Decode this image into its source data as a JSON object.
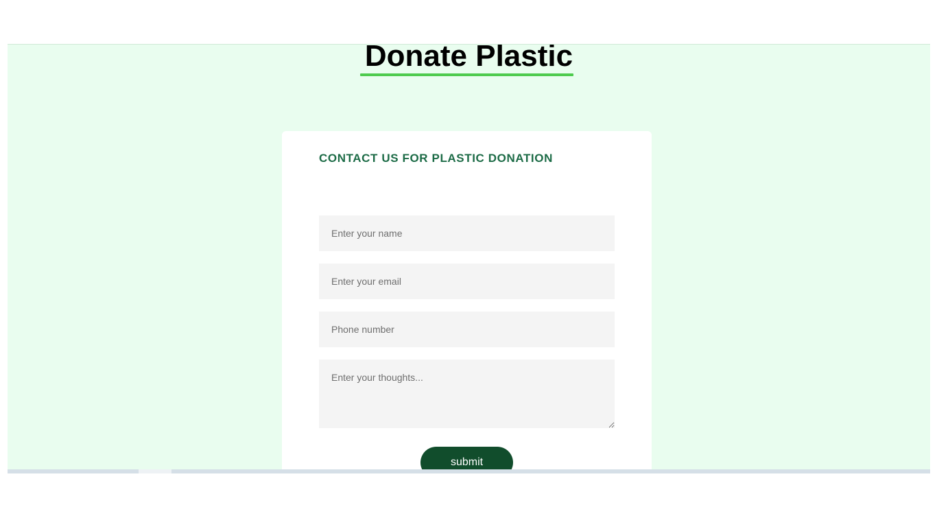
{
  "page": {
    "title": "Donate Plastic"
  },
  "form": {
    "heading": "CONTACT US FOR PLASTIC DONATION",
    "name_placeholder": "Enter your name",
    "email_placeholder": "Enter your email",
    "phone_placeholder": "Phone number",
    "thoughts_placeholder": "Enter your thoughts...",
    "submit_label": "submit"
  },
  "colors": {
    "page_background": "#e9fdef",
    "title_underline": "#4ecb4e",
    "heading_text": "#1c6b46",
    "submit_button": "#114d2c",
    "field_background": "#f4f4f4"
  }
}
